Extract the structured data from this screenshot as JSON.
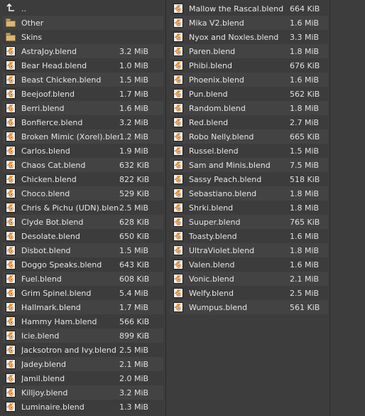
{
  "left_column": [
    {
      "kind": "parent",
      "name": "..",
      "size": "",
      "icon": "parent-directory-icon"
    },
    {
      "kind": "folder",
      "name": "Other",
      "size": "",
      "icon": "folder-icon"
    },
    {
      "kind": "folder",
      "name": "Skins",
      "size": "",
      "icon": "folder-icon"
    },
    {
      "kind": "file",
      "name": "AstraJoy.blend",
      "size": "3.2 MiB",
      "icon": "blend-file-icon"
    },
    {
      "kind": "file",
      "name": "Bear Head.blend",
      "size": "1.0 MiB",
      "icon": "blend-file-icon"
    },
    {
      "kind": "file",
      "name": "Beast Chicken.blend",
      "size": "1.5 MiB",
      "icon": "blend-file-icon"
    },
    {
      "kind": "file",
      "name": "Beejoof.blend",
      "size": "1.7 MiB",
      "icon": "blend-file-icon"
    },
    {
      "kind": "file",
      "name": "Berri.blend",
      "size": "1.6 MiB",
      "icon": "blend-file-icon"
    },
    {
      "kind": "file",
      "name": "Bonfierce.blend",
      "size": "3.2 MiB",
      "icon": "blend-file-icon"
    },
    {
      "kind": "file",
      "name": "Broken Mimic (Xorel).blend",
      "size": "1.2 MiB",
      "icon": "blend-file-icon"
    },
    {
      "kind": "file",
      "name": "Carlos.blend",
      "size": "1.9 MiB",
      "icon": "blend-file-icon"
    },
    {
      "kind": "file",
      "name": "Chaos Cat.blend",
      "size": "632 KiB",
      "icon": "blend-file-icon"
    },
    {
      "kind": "file",
      "name": "Chicken.blend",
      "size": "822 KiB",
      "icon": "blend-file-icon"
    },
    {
      "kind": "file",
      "name": "Choco.blend",
      "size": "529 KiB",
      "icon": "blend-file-icon"
    },
    {
      "kind": "file",
      "name": "Chris & Pichu (UDN).blend",
      "size": "2.5 MiB",
      "icon": "blend-file-icon"
    },
    {
      "kind": "file",
      "name": "Clyde Bot.blend",
      "size": "628 KiB",
      "icon": "blend-file-icon"
    },
    {
      "kind": "file",
      "name": "Desolate.blend",
      "size": "650 KiB",
      "icon": "blend-file-icon"
    },
    {
      "kind": "file",
      "name": "Disbot.blend",
      "size": "1.5 MiB",
      "icon": "blend-file-icon"
    },
    {
      "kind": "file",
      "name": "Doggo Speaks.blend",
      "size": "643 KiB",
      "icon": "blend-file-icon"
    },
    {
      "kind": "file",
      "name": "Fuel.blend",
      "size": "608 KiB",
      "icon": "blend-file-icon"
    },
    {
      "kind": "file",
      "name": "Grim Spinel.blend",
      "size": "5.4 MiB",
      "icon": "blend-file-icon"
    },
    {
      "kind": "file",
      "name": "Hallmark.blend",
      "size": "1.7 MiB",
      "icon": "blend-file-icon"
    },
    {
      "kind": "file",
      "name": "Hammy Ham.blend",
      "size": "566 KiB",
      "icon": "blend-file-icon"
    },
    {
      "kind": "file",
      "name": "Icie.blend",
      "size": "899 KiB",
      "icon": "blend-file-icon"
    },
    {
      "kind": "file",
      "name": "Jacksotron and Ivy.blend",
      "size": "2.5 MiB",
      "icon": "blend-file-icon"
    },
    {
      "kind": "file",
      "name": "Jadey.blend",
      "size": "2.1 MiB",
      "icon": "blend-file-icon"
    },
    {
      "kind": "file",
      "name": "Jamil.blend",
      "size": "2.0 MiB",
      "icon": "blend-file-icon"
    },
    {
      "kind": "file",
      "name": "Killjoy.blend",
      "size": "3.2 MiB",
      "icon": "blend-file-icon"
    },
    {
      "kind": "file",
      "name": "Luminaire.blend",
      "size": "1.3 MiB",
      "icon": "blend-file-icon"
    }
  ],
  "right_column": [
    {
      "kind": "file",
      "name": "Mallow the Rascal.blend",
      "size": "664 KiB",
      "icon": "blend-file-icon"
    },
    {
      "kind": "file",
      "name": "Mika V2.blend",
      "size": "1.6 MiB",
      "icon": "blend-file-icon"
    },
    {
      "kind": "file",
      "name": "Nyox and Noxles.blend",
      "size": "3.3 MiB",
      "icon": "blend-file-icon"
    },
    {
      "kind": "file",
      "name": "Paren.blend",
      "size": "1.8 MiB",
      "icon": "blend-file-icon"
    },
    {
      "kind": "file",
      "name": "Phibi.blend",
      "size": "676 KiB",
      "icon": "blend-file-icon"
    },
    {
      "kind": "file",
      "name": "Phoenix.blend",
      "size": "1.6 MiB",
      "icon": "blend-file-icon"
    },
    {
      "kind": "file",
      "name": "Pun.blend",
      "size": "562 KiB",
      "icon": "blend-file-icon"
    },
    {
      "kind": "file",
      "name": "Random.blend",
      "size": "1.8 MiB",
      "icon": "blend-file-icon"
    },
    {
      "kind": "file",
      "name": "Red.blend",
      "size": "2.7 MiB",
      "icon": "blend-file-icon"
    },
    {
      "kind": "file",
      "name": "Robo Nelly.blend",
      "size": "665 KiB",
      "icon": "blend-file-icon"
    },
    {
      "kind": "file",
      "name": "Russel.blend",
      "size": "1.5 MiB",
      "icon": "blend-file-icon"
    },
    {
      "kind": "file",
      "name": "Sam and Minis.blend",
      "size": "7.5 MiB",
      "icon": "blend-file-icon"
    },
    {
      "kind": "file",
      "name": "Sassy Peach.blend",
      "size": "518 KiB",
      "icon": "blend-file-icon"
    },
    {
      "kind": "file",
      "name": "Sebastiano.blend",
      "size": "1.8 MiB",
      "icon": "blend-file-icon"
    },
    {
      "kind": "file",
      "name": "Shrki.blend",
      "size": "1.8 MiB",
      "icon": "blend-file-icon"
    },
    {
      "kind": "file",
      "name": "Suuper.blend",
      "size": "765 KiB",
      "icon": "blend-file-icon"
    },
    {
      "kind": "file",
      "name": "Toasty.blend",
      "size": "1.6 MiB",
      "icon": "blend-file-icon"
    },
    {
      "kind": "file",
      "name": "UltraViolet.blend",
      "size": "1.8 MiB",
      "icon": "blend-file-icon"
    },
    {
      "kind": "file",
      "name": "Valen.blend",
      "size": "1.6 MiB",
      "icon": "blend-file-icon"
    },
    {
      "kind": "file",
      "name": "Vonic.blend",
      "size": "2.1 MiB",
      "icon": "blend-file-icon"
    },
    {
      "kind": "file",
      "name": "Welfy.blend",
      "size": "2.5 MiB",
      "icon": "blend-file-icon"
    },
    {
      "kind": "file",
      "name": "Wumpus.blend",
      "size": "561 KiB",
      "icon": "blend-file-icon"
    }
  ],
  "colors": {
    "background": "#3d3d3d",
    "row_even": "#434343",
    "row_odd": "#3c3c3c",
    "text": "#e6e6e6",
    "folder": "#d8b679",
    "blend_icon_orange": "#e87d0d",
    "blend_icon_blue": "#265787"
  }
}
